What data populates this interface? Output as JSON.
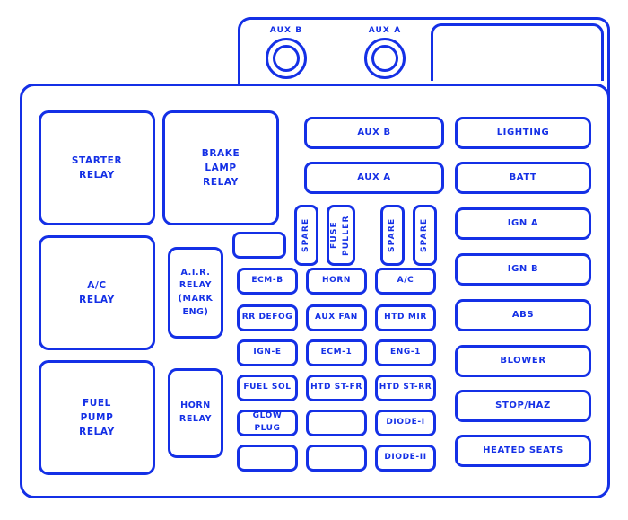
{
  "diagram": {
    "title": "Fuse Box / Relay Panel Diagram",
    "accent_color": "#1430e6",
    "background_color": "#ffffff"
  },
  "top_terminals": [
    {
      "label": "AUX B",
      "name": "terminal-aux-b"
    },
    {
      "label": "AUX A",
      "name": "terminal-aux-a"
    }
  ],
  "relays": {
    "starter": {
      "lines": [
        "STARTER",
        "RELAY"
      ]
    },
    "brake_lamp": {
      "lines": [
        "BRAKE",
        "LAMP",
        "RELAY"
      ]
    },
    "ac": {
      "lines": [
        "A/C",
        "RELAY"
      ]
    },
    "air": {
      "lines": [
        "A.I.R.",
        "RELAY",
        "(MARK",
        "ENG)"
      ]
    },
    "fuel_pump": {
      "lines": [
        "FUEL",
        "PUMP",
        "RELAY"
      ]
    },
    "horn": {
      "lines": [
        "HORN",
        "RELAY"
      ]
    }
  },
  "aux_bars": [
    {
      "label": "AUX B"
    },
    {
      "label": "AUX A"
    }
  ],
  "vertical_slots": [
    {
      "lines": [
        "SPARE"
      ]
    },
    {
      "lines": [
        "FUSE",
        "PULLER"
      ]
    },
    {
      "lines": [
        "SPARE"
      ]
    },
    {
      "lines": [
        "SPARE"
      ]
    }
  ],
  "blank_slot_top": {
    "label": ""
  },
  "fuse_grid": {
    "columns": [
      {
        "name": "fuse-column-1",
        "cells": [
          {
            "label": "ECM-B"
          },
          {
            "label": "RR DEFOG"
          },
          {
            "label": "IGN-E"
          },
          {
            "label": "FUEL SOL"
          },
          {
            "label": "GLOW PLUG"
          },
          {
            "label": ""
          }
        ]
      },
      {
        "name": "fuse-column-2",
        "cells": [
          {
            "label": "HORN"
          },
          {
            "label": "AUX FAN"
          },
          {
            "label": "ECM-1"
          },
          {
            "label": "HTD ST-FR"
          },
          {
            "label": ""
          },
          {
            "label": ""
          }
        ]
      },
      {
        "name": "fuse-column-3",
        "cells": [
          {
            "label": "A/C"
          },
          {
            "label": "HTD MIR"
          },
          {
            "label": "ENG-1"
          },
          {
            "label": "HTD ST-RR"
          },
          {
            "label": "DIODE-I"
          },
          {
            "label": "DIODE-II"
          }
        ]
      }
    ]
  },
  "right_column": {
    "name": "right-fuse-column",
    "cells": [
      {
        "label": "LIGHTING"
      },
      {
        "label": "BATT"
      },
      {
        "label": "IGN A"
      },
      {
        "label": "IGN B"
      },
      {
        "label": "ABS"
      },
      {
        "label": "BLOWER"
      },
      {
        "label": "STOP/HAZ"
      },
      {
        "label": "HEATED SEATS"
      }
    ]
  }
}
